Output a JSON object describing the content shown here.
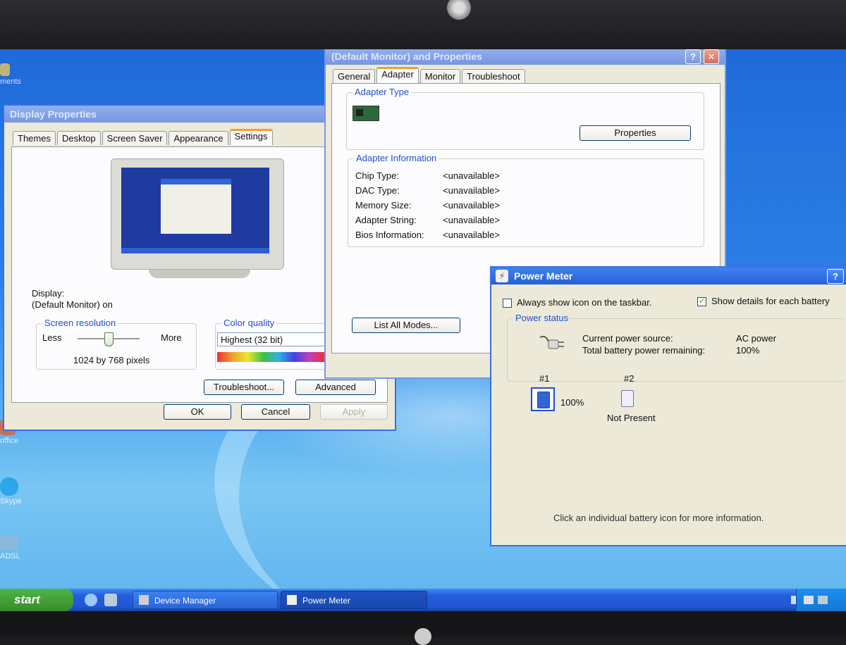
{
  "desktop": {
    "icons": [
      {
        "label": "ments",
        "icon": "folder-icon"
      },
      {
        "label": "office",
        "icon": "office-icon"
      },
      {
        "label": "Skype",
        "icon": "skype-icon"
      },
      {
        "label": "ADSL",
        "icon": "network-icon"
      }
    ]
  },
  "display_props": {
    "title": "Display Properties",
    "tabs": [
      "Themes",
      "Desktop",
      "Screen Saver",
      "Appearance",
      "Settings"
    ],
    "display_label": "Display:",
    "display_value": "(Default Monitor) on",
    "resolution": {
      "label": "Screen resolution",
      "less": "Less",
      "more": "More",
      "value": "1024 by 768 pixels"
    },
    "color": {
      "label": "Color quality",
      "value": "Highest (32 bit)"
    },
    "buttons": {
      "troubleshoot": "Troubleshoot...",
      "advanced": "Advanced",
      "ok": "OK",
      "cancel": "Cancel",
      "apply": "Apply"
    }
  },
  "monitor_props": {
    "title": "(Default Monitor) and  Properties",
    "tabs": [
      "General",
      "Adapter",
      "Monitor",
      "Troubleshoot"
    ],
    "adapter_type": {
      "label": "Adapter Type",
      "button": "Properties"
    },
    "adapter_info": {
      "label": "Adapter Information",
      "rows": [
        {
          "key": "Chip Type:",
          "value": "<unavailable>"
        },
        {
          "key": "DAC Type:",
          "value": "<unavailable>"
        },
        {
          "key": "Memory Size:",
          "value": "<unavailable>"
        },
        {
          "key": "Adapter String:",
          "value": "<unavailable>"
        },
        {
          "key": "Bios Information:",
          "value": "<unavailable>"
        }
      ]
    },
    "list_modes": "List All Modes...",
    "help": "?",
    "close": "✕"
  },
  "power_meter": {
    "title": "Power Meter",
    "help": "?",
    "always_show": "Always show icon on the taskbar.",
    "show_details": "Show details for each battery",
    "status_label": "Power status",
    "source_key": "Current power source:",
    "source_value": "AC power",
    "remaining_key": "Total battery power remaining:",
    "remaining_value": "100%",
    "battery1": {
      "id": "#1",
      "value": "100%",
      "level": 1.0
    },
    "battery2": {
      "id": "#2",
      "value": "Not Present"
    },
    "hint": "Click an individual battery icon for more information."
  },
  "taskbar": {
    "start": "start",
    "tasks": [
      "Device Manager",
      "Power Meter"
    ]
  }
}
